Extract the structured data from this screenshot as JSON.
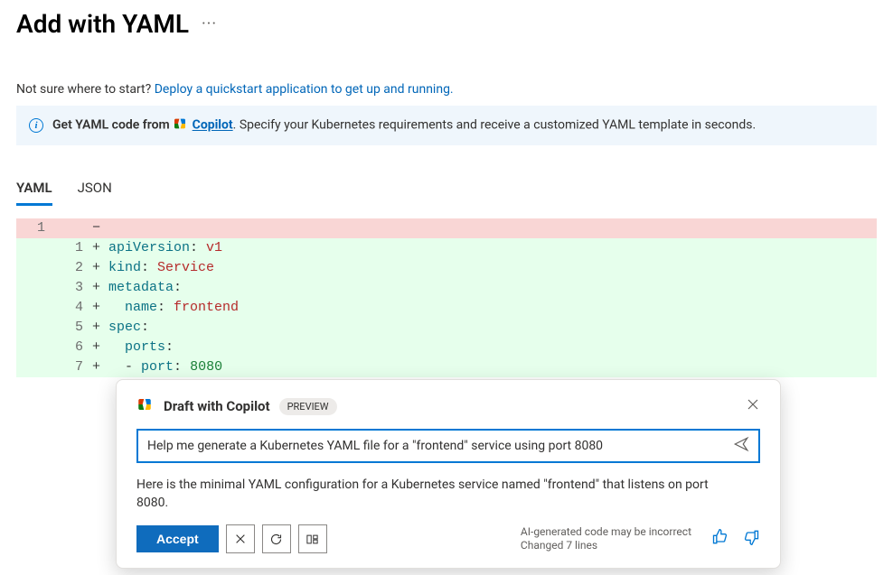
{
  "header": {
    "title": "Add with YAML"
  },
  "subtitle": {
    "prefix": "Not sure where to start? ",
    "link_text": "Deploy a quickstart application to get up and running."
  },
  "banner": {
    "lead": "Get YAML code from ",
    "copilot_label": "Copilot",
    "trail": ". Specify your Kubernetes requirements and receive a customized YAML template in seconds."
  },
  "tabs": [
    "YAML",
    "JSON"
  ],
  "active_tab": 0,
  "diff": {
    "removed": [
      {
        "old": "1",
        "new": "",
        "text": ""
      }
    ],
    "added": [
      {
        "new": "1",
        "tokens": [
          [
            "key",
            "apiVersion"
          ],
          [
            "punc",
            ": "
          ],
          [
            "str",
            "v1"
          ]
        ]
      },
      {
        "new": "2",
        "tokens": [
          [
            "key",
            "kind"
          ],
          [
            "punc",
            ": "
          ],
          [
            "str",
            "Service"
          ]
        ]
      },
      {
        "new": "3",
        "tokens": [
          [
            "key",
            "metadata"
          ],
          [
            "punc",
            ":"
          ]
        ]
      },
      {
        "new": "4",
        "tokens": [
          [
            "plain",
            "  "
          ],
          [
            "key",
            "name"
          ],
          [
            "punc",
            ": "
          ],
          [
            "str",
            "frontend"
          ]
        ]
      },
      {
        "new": "5",
        "tokens": [
          [
            "key",
            "spec"
          ],
          [
            "punc",
            ":"
          ]
        ]
      },
      {
        "new": "6",
        "tokens": [
          [
            "plain",
            "  "
          ],
          [
            "key",
            "ports"
          ],
          [
            "punc",
            ":"
          ]
        ]
      },
      {
        "new": "7",
        "tokens": [
          [
            "plain",
            "  "
          ],
          [
            "punc",
            "- "
          ],
          [
            "key",
            "port"
          ],
          [
            "punc",
            ": "
          ],
          [
            "num",
            "8080"
          ]
        ]
      }
    ]
  },
  "copilot_popup": {
    "title": "Draft with Copilot",
    "badge": "PREVIEW",
    "input_value": "Help me generate a Kubernetes YAML file for a \"frontend\" service using port 8080",
    "response": "Here is the minimal YAML configuration for a Kubernetes service named \"frontend\" that listens on port 8080.",
    "accept_label": "Accept",
    "ai_note_line1": "AI-generated code may be incorrect",
    "ai_note_line2": "Changed 7 lines"
  }
}
